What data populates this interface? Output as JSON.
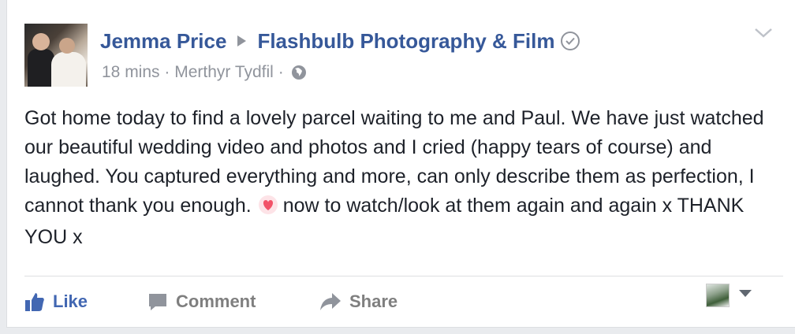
{
  "post": {
    "author": "Jemma Price",
    "page": "Flashbulb Photography & Film",
    "time": "18 mins",
    "separator": " · ",
    "location": "Merthyr Tydfil",
    "separator2": " ·",
    "icons": {
      "audience": "globe-icon",
      "verified": "check-circle-icon",
      "menu": "chevron-down-icon",
      "emoji": "heart-emoji-icon"
    },
    "text_part1": "Got home today to find a lovely parcel waiting to me and Paul. We have just watched our beautiful wedding video and photos and I cried (happy tears of course) and laughed. You captured everything and more, can only describe them as perfection, I cannot thank you enough.",
    "text_part2": "now to watch/look at them again and again x THANK YOU x"
  },
  "actions": {
    "like": "Like",
    "comment": "Comment",
    "share": "Share"
  },
  "colors": {
    "link": "#365899",
    "like_active": "#4267b2",
    "muted": "#90949c",
    "text": "#1d2129",
    "heart": "#f25268"
  }
}
